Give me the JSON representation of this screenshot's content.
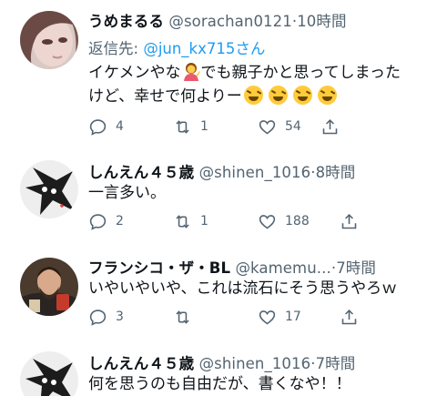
{
  "tweets": [
    {
      "name": "うめまるる",
      "handle": "@sorachan0121",
      "dot": "·",
      "time": "10時間",
      "reply_prefix": "返信先: ",
      "reply_handle": "@jun_kx715",
      "reply_suffix": "さん",
      "text_line1_a": "イケメンやな",
      "text_line1_b": "でも親子かと思ってしまった",
      "text_line2": "けど、幸せで何よりー",
      "emoji_names": [
        "person-tipping-hand-icon",
        "laughing-face-icon",
        "laughing-face-icon",
        "laughing-face-icon",
        "laughing-face-icon"
      ],
      "replies": "4",
      "retweets": "1",
      "likes": "54"
    },
    {
      "name": "しんえん４５歳",
      "handle": "@shinen_1016",
      "dot": "·",
      "time": "8時間",
      "text": "一言多い。",
      "replies": "2",
      "retweets": "1",
      "likes": "188"
    },
    {
      "name": "フランシコ・ザ・BL",
      "handle": "@kamemu...",
      "dot": "·",
      "time": "7時間",
      "text": "いやいやいや、これは流石にそう思うやろｗ",
      "replies": "3",
      "retweets": "",
      "likes": "17"
    },
    {
      "name": "しんえん４５歳",
      "handle": "@shinen_1016",
      "dot": "·",
      "time": "7時間",
      "text": "何を思うのも自由だが、書くなや！！"
    }
  ],
  "colors": {
    "text": "#0f1419",
    "secondary": "#536471",
    "link": "#1d9bf0",
    "background": "#ffffff"
  }
}
